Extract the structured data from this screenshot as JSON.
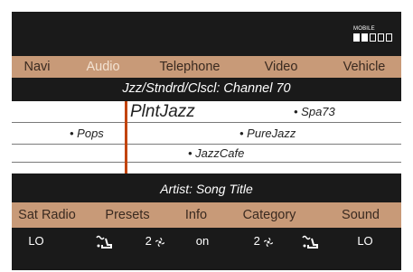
{
  "signal": {
    "label": "MOBILE",
    "bars_total": 5,
    "bars_filled": 2
  },
  "top_menu": [
    {
      "label": "Navi",
      "active": false
    },
    {
      "label": "Audio",
      "active": true
    },
    {
      "label": "Telephone",
      "active": false
    },
    {
      "label": "Video",
      "active": false
    },
    {
      "label": "Vehicle",
      "active": false
    }
  ],
  "channel_header": "Jzz/Stndrd/Clscl: Channel 70",
  "channels": {
    "selected": "PlntJazz",
    "spa": "• Spa73",
    "pops": "• Pops",
    "purejazz": "• PureJazz",
    "jazzcafe": "• JazzCafe"
  },
  "artist_line": "Artist: Song Title",
  "bottom_menu": [
    {
      "label": "Sat Radio"
    },
    {
      "label": "Presets"
    },
    {
      "label": "Info"
    },
    {
      "label": "Category"
    },
    {
      "label": "Sound"
    }
  ],
  "status": {
    "left_temp": "LO",
    "fan_left": "2",
    "ac": "on",
    "fan_right": "2",
    "right_temp": "LO"
  },
  "colors": {
    "menu_bar": "#c89a78",
    "menu_text": "#3a2a20",
    "active_menu_text": "#f3e2d2",
    "cursor": "#c2440b",
    "screen_bg": "#1a1a1a"
  },
  "icons": {
    "seat_left": "seat-heat-icon",
    "fan": "fan-icon",
    "seat_right": "seat-heat-icon"
  }
}
